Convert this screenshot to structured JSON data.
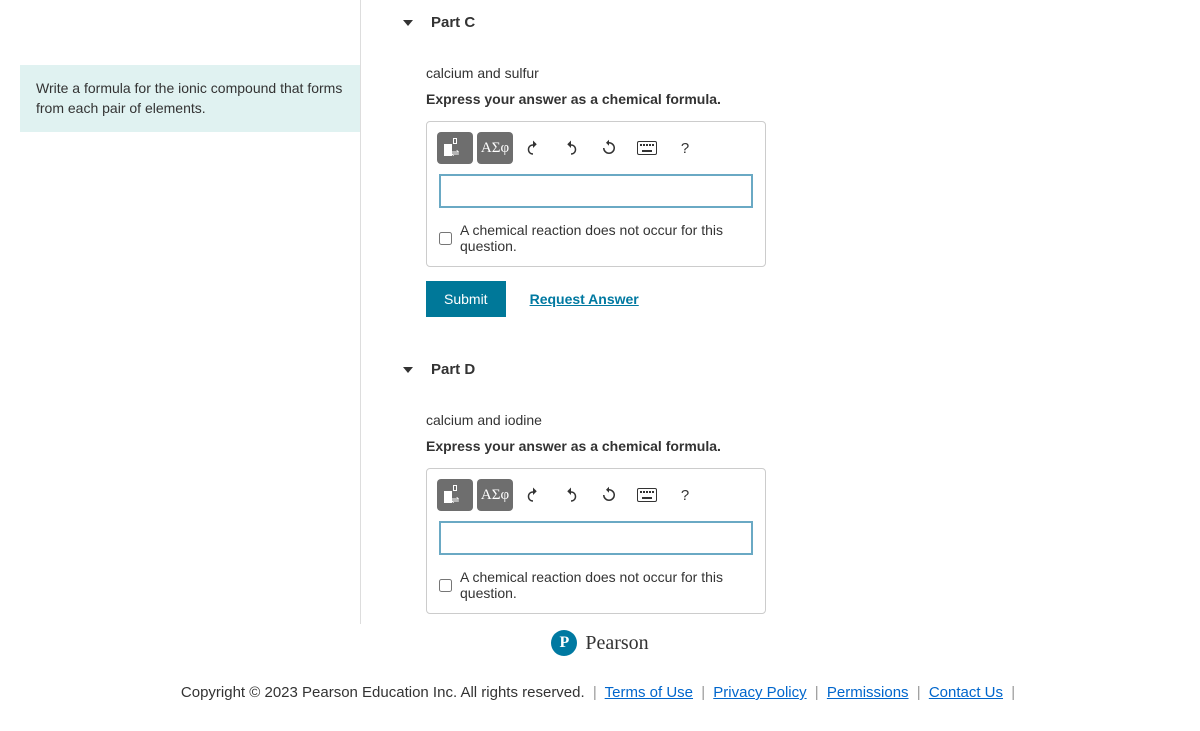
{
  "instruction": "Write a formula for the ionic compound that forms from each pair of elements.",
  "parts": [
    {
      "id": "C",
      "title": "Part C",
      "prompt": "calcium and sulfur",
      "instr": "Express your answer as a chemical formula.",
      "checkbox_label": "A chemical reaction does not occur for this question.",
      "submit_label": "Submit",
      "request_label": "Request Answer",
      "toolbar": {
        "greek": "ΑΣφ",
        "help": "?"
      }
    },
    {
      "id": "D",
      "title": "Part D",
      "prompt": "calcium and iodine",
      "instr": "Express your answer as a chemical formula.",
      "checkbox_label": "A chemical reaction does not occur for this question.",
      "toolbar": {
        "greek": "ΑΣφ",
        "help": "?"
      }
    }
  ],
  "brand": "Pearson",
  "footer": {
    "copyright": "Copyright © 2023 Pearson Education Inc. All rights reserved.",
    "links": [
      "Terms of Use",
      "Privacy Policy",
      "Permissions",
      "Contact Us"
    ]
  }
}
